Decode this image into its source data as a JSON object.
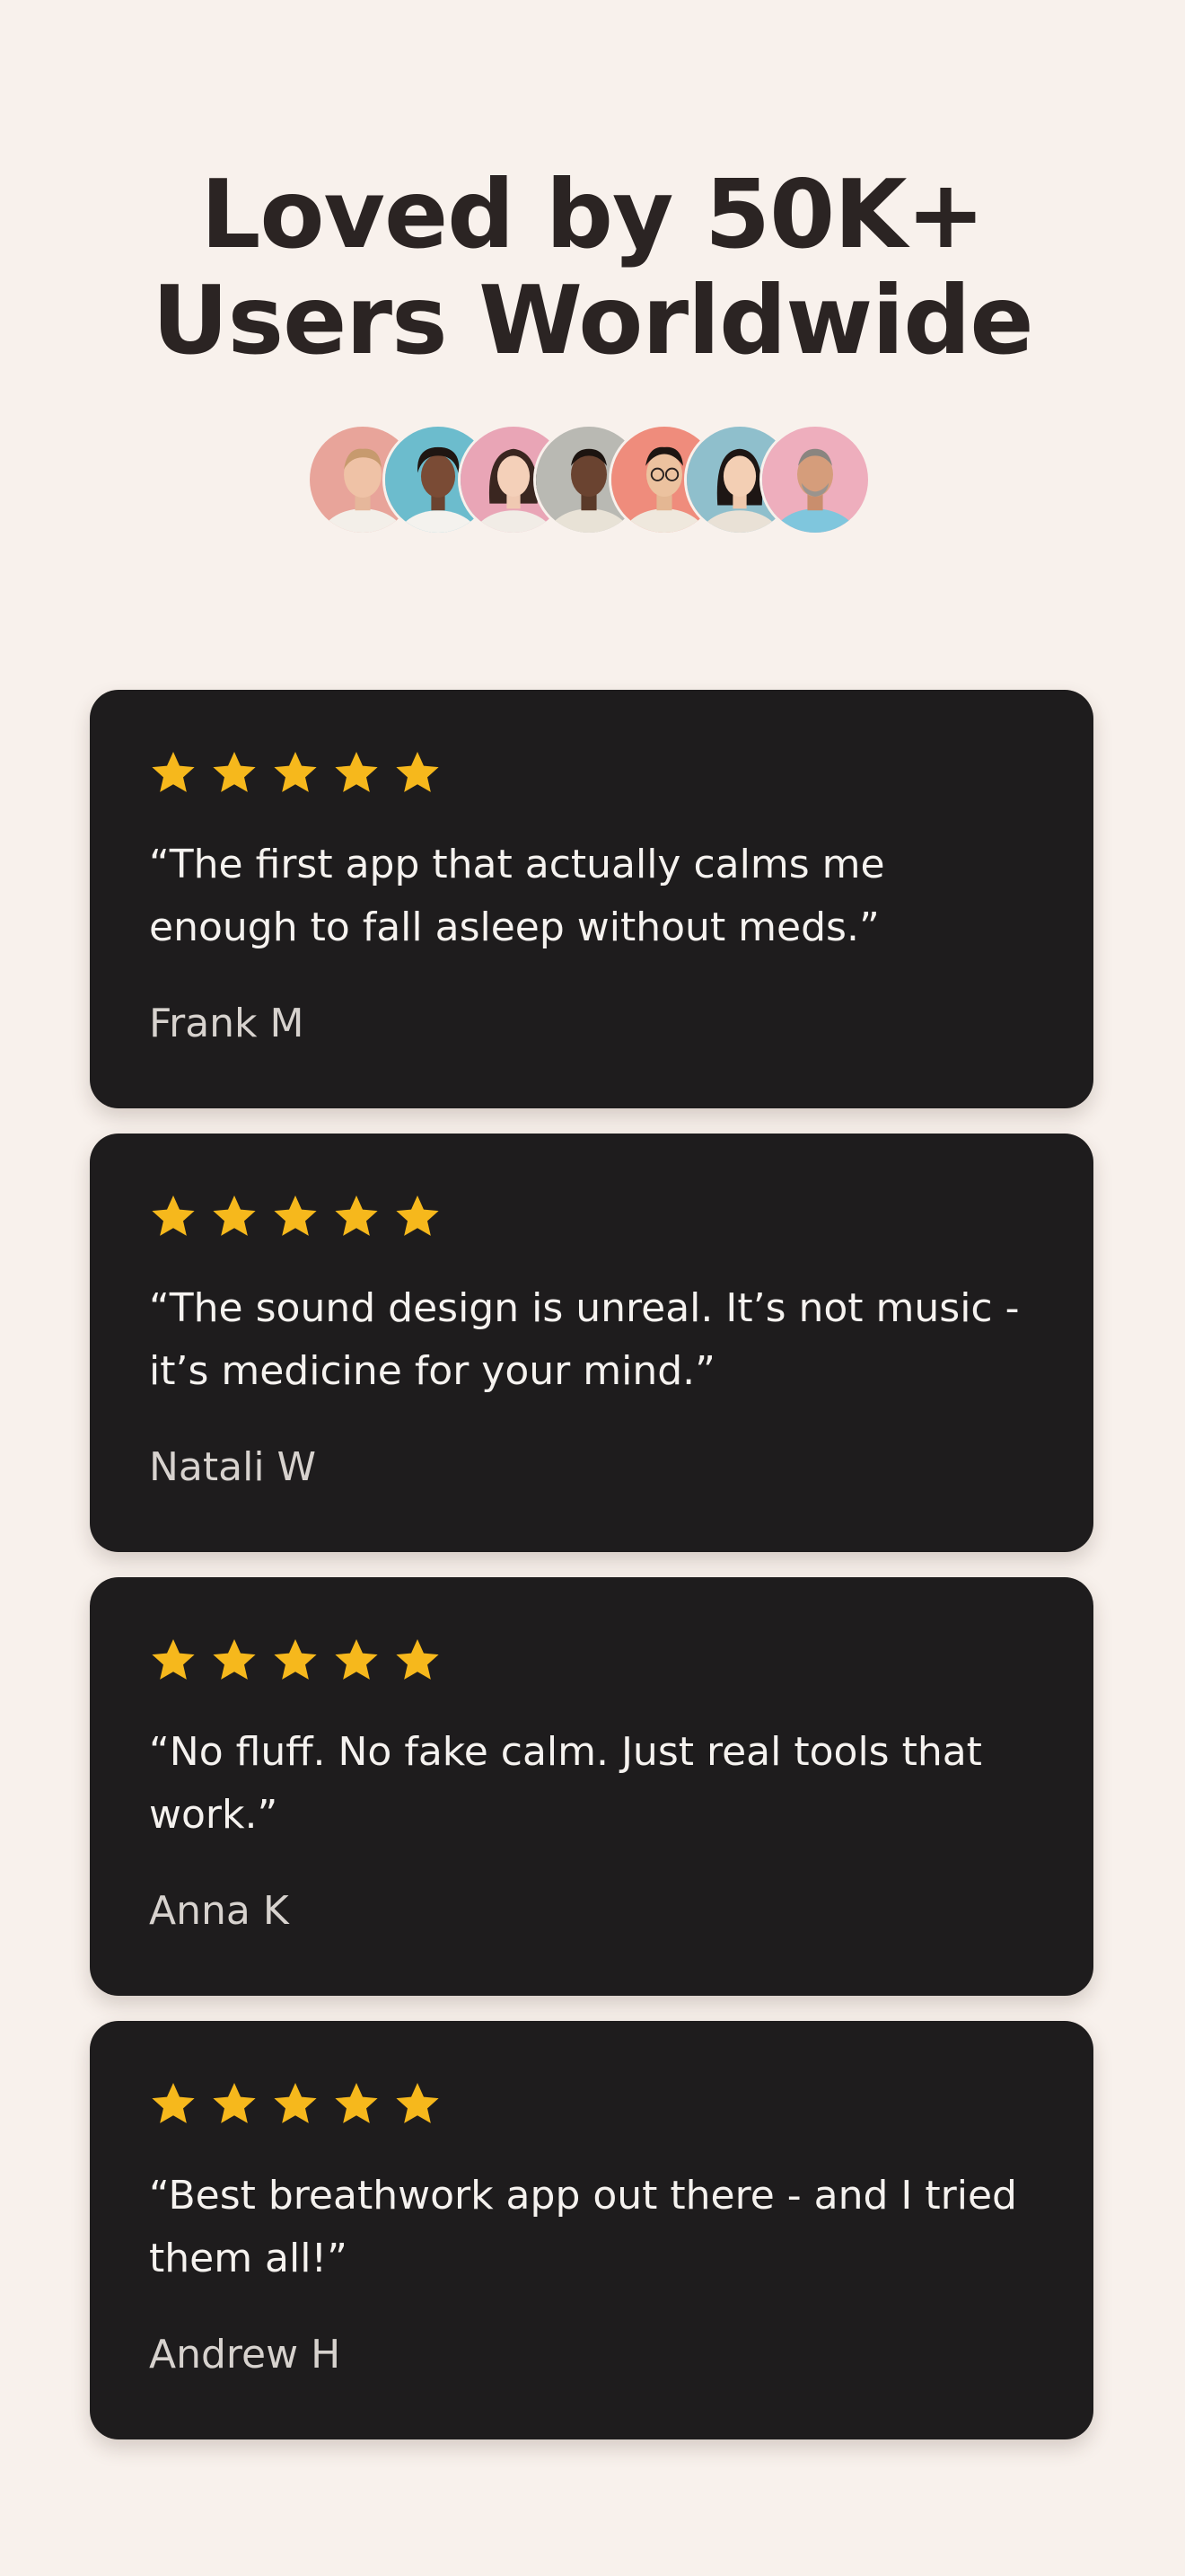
{
  "header": {
    "title_line1": "Loved by 50K+",
    "title_line2": "Users Worldwide"
  },
  "avatars": [
    {
      "name": "avatar-1",
      "bg": "#e8a49a"
    },
    {
      "name": "avatar-2",
      "bg": "#6cbccd"
    },
    {
      "name": "avatar-3",
      "bg": "#e9a5b6"
    },
    {
      "name": "avatar-4",
      "bg": "#b9b9b3"
    },
    {
      "name": "avatar-5",
      "bg": "#ef8c7c"
    },
    {
      "name": "avatar-6",
      "bg": "#8fbfcc"
    },
    {
      "name": "avatar-7",
      "bg": "#eeaebd"
    }
  ],
  "colors": {
    "background": "#f8f1ec",
    "card": "#1e1c1d",
    "star": "#f6b81c",
    "headline": "#2b2423"
  },
  "reviews": [
    {
      "rating": 5,
      "quote_line1": "“The first app that actually calms me",
      "quote_line2": "enough to fall asleep without meds.”",
      "author": "Frank M"
    },
    {
      "rating": 5,
      "quote_line1": "“The sound design is unreal. It’s not music -",
      "quote_line2": "it’s medicine for your mind.”",
      "author": "Natali W"
    },
    {
      "rating": 5,
      "quote_line1": "“No fluff. No fake calm. Just real tools that",
      "quote_line2": "work.”",
      "author": "Anna K"
    },
    {
      "rating": 5,
      "quote_line1": "“Best breathwork app out there - and I tried",
      "quote_line2": "them all!”",
      "author": "Andrew H"
    }
  ]
}
